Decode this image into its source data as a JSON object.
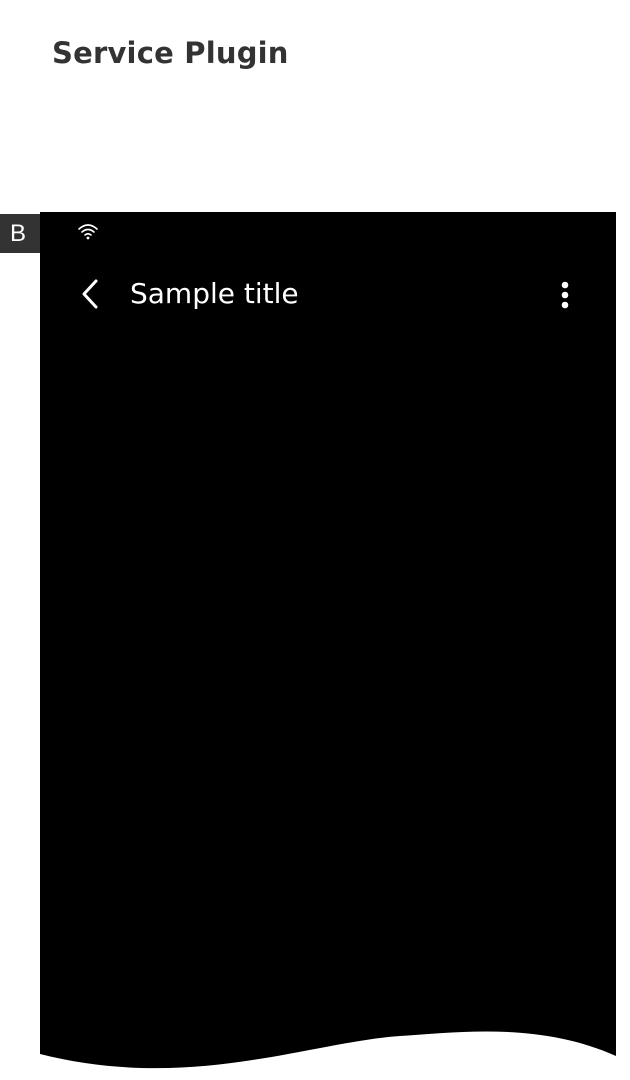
{
  "page": {
    "section_title": "Service Plugin",
    "variant_label": "B"
  },
  "phone": {
    "status_bar": {
      "wifi_icon": "wifi-icon"
    },
    "app_bar": {
      "title": "Sample title",
      "back_icon": "chevron-left-icon",
      "more_icon": "more-vertical-icon"
    }
  },
  "colors": {
    "page_background": "#ffffff",
    "section_title": "#333333",
    "badge_background": "#333333",
    "phone_background": "#000000",
    "app_bar_text": "#ffffff"
  }
}
